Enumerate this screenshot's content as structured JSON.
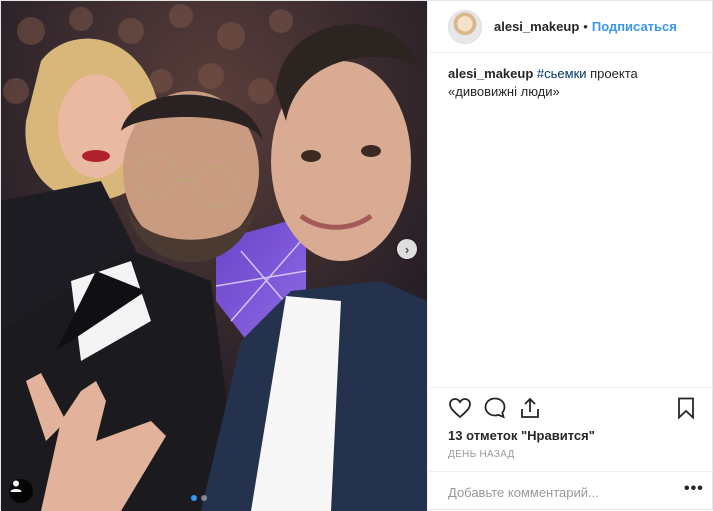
{
  "header": {
    "username": "alesi_makeup",
    "separator": "•",
    "follow_label": "Подписаться",
    "avatar_icon": "profile-avatar"
  },
  "caption": {
    "username": "alesi_makeup",
    "hashtag": "#сьемки",
    "text": " проекта «дивовижні люди»"
  },
  "actions": {
    "like_icon": "heart-icon",
    "comment_icon": "comment-icon",
    "share_icon": "share-icon",
    "save_icon": "bookmark-icon",
    "likes_text": "13 отметок \"Нравится\"",
    "time_text": "День назад"
  },
  "comment": {
    "placeholder": "Добавьте комментарий...",
    "more_label": "•••"
  },
  "photo": {
    "carousel_total": 2,
    "carousel_active": 1,
    "next_icon": "chevron-right-icon",
    "tag_icon": "user-tag-icon"
  },
  "colors": {
    "link_blue": "#3897f0",
    "hashtag": "#003569",
    "muted": "#999999",
    "border": "#efefef"
  }
}
